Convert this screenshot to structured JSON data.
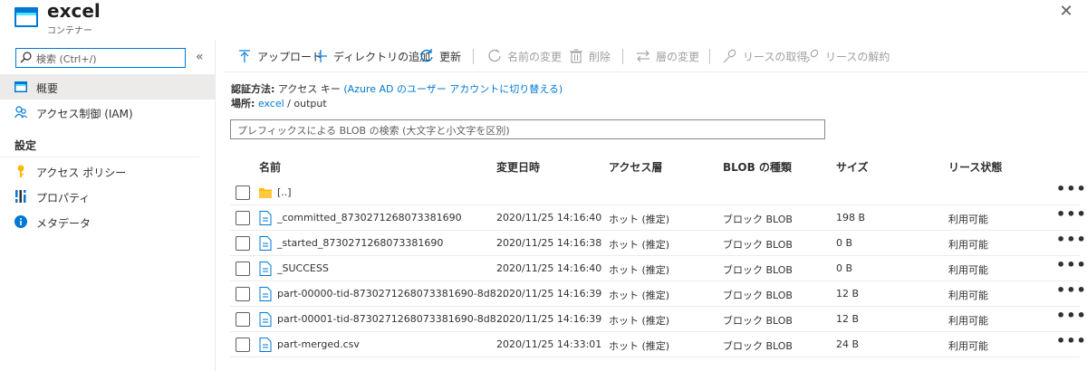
{
  "header": {
    "title": "excel",
    "subtitle": "コンテナー",
    "close_label": "✕"
  },
  "sidebar": {
    "search_placeholder": "検索 (Ctrl+/)",
    "collapse_label": "«",
    "items": [
      {
        "label": "概要",
        "icon": "overview-icon"
      },
      {
        "label": "アクセス制御 (IAM)",
        "icon": "people-icon"
      }
    ],
    "settings_heading": "設定",
    "settings_items": [
      {
        "label": "アクセス ポリシー",
        "icon": "key-icon"
      },
      {
        "label": "プロパティ",
        "icon": "properties-icon"
      },
      {
        "label": "メタデータ",
        "icon": "info-icon"
      }
    ]
  },
  "toolbar": {
    "upload": "アップロード",
    "add_directory": "ディレクトリの追加",
    "refresh": "更新",
    "rename": "名前の変更",
    "delete": "削除",
    "change_tier": "層の変更",
    "acquire_lease": "リースの取得",
    "break_lease": "リースの解約"
  },
  "info": {
    "auth_label": "認証方法:",
    "auth_value": "アクセス キー",
    "auth_link": "(Azure AD のユーザー アカウントに切り替える)",
    "location_label": "場所:",
    "location_link": "excel",
    "location_sep": "/",
    "location_path": "output"
  },
  "blob_search": {
    "placeholder": "プレフィックスによる BLOB の検索 (大文字と小文字を区別)"
  },
  "table": {
    "headers": {
      "name": "名前",
      "modified": "変更日時",
      "tier": "アクセス層",
      "type": "BLOB の種類",
      "size": "サイズ",
      "lease": "リース状態"
    },
    "more_label": "•••",
    "rows": [
      {
        "name": "[..]",
        "modified": "",
        "tier": "",
        "type": "",
        "size": "",
        "lease": "",
        "kind": "folder"
      },
      {
        "name": "_committed_8730271268073381690",
        "modified": "2020/11/25 14:16:40",
        "tier": "ホット (推定)",
        "type": "ブロック BLOB",
        "size": "198 B",
        "lease": "利用可能",
        "kind": "file"
      },
      {
        "name": "_started_8730271268073381690",
        "modified": "2020/11/25 14:16:38",
        "tier": "ホット (推定)",
        "type": "ブロック BLOB",
        "size": "0 B",
        "lease": "利用可能",
        "kind": "file"
      },
      {
        "name": "_SUCCESS",
        "modified": "2020/11/25 14:16:40",
        "tier": "ホット (推定)",
        "type": "ブロック BLOB",
        "size": "0 B",
        "lease": "利用可能",
        "kind": "file"
      },
      {
        "name": "part-00000-tid-8730271268073381690-8d8...",
        "modified": "2020/11/25 14:16:39",
        "tier": "ホット (推定)",
        "type": "ブロック BLOB",
        "size": "12 B",
        "lease": "利用可能",
        "kind": "file"
      },
      {
        "name": "part-00001-tid-8730271268073381690-8d8...",
        "modified": "2020/11/25 14:16:39",
        "tier": "ホット (推定)",
        "type": "ブロック BLOB",
        "size": "12 B",
        "lease": "利用可能",
        "kind": "file"
      },
      {
        "name": "part-merged.csv",
        "modified": "2020/11/25 14:33:01",
        "tier": "ホット (推定)",
        "type": "ブロック BLOB",
        "size": "24 B",
        "lease": "利用可能",
        "kind": "file"
      }
    ]
  },
  "colors": {
    "accent": "#0078d4",
    "folder": "#ffb900",
    "disabled": "#a19f9d"
  }
}
